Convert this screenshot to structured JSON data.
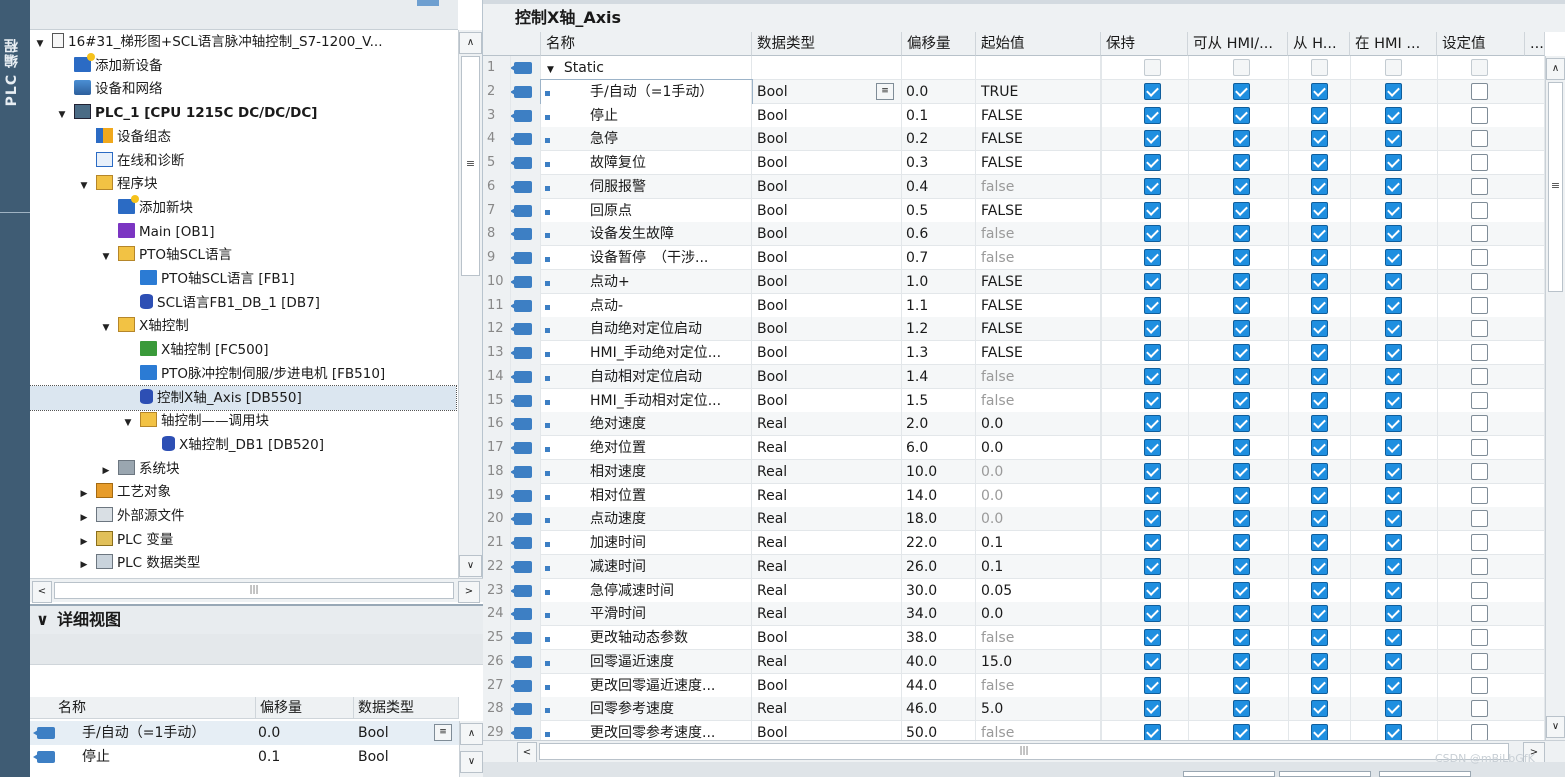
{
  "side_tab": {
    "label": "PLC 编程"
  },
  "tree": {
    "items": [
      {
        "label": "16#31_梯形图+SCL语言脉冲轴控制_S7-1200_V...",
        "icon": "project-icon",
        "toggle": "▼",
        "indent": 0
      },
      {
        "label": "添加新设备",
        "icon": "add-device-icon",
        "toggle": "",
        "indent": 1
      },
      {
        "label": "设备和网络",
        "icon": "network-icon",
        "toggle": "",
        "indent": 1
      },
      {
        "label": "PLC_1 [CPU 1215C DC/DC/DC]",
        "icon": "plc-icon",
        "toggle": "▼",
        "indent": 1
      },
      {
        "label": "设备组态",
        "icon": "device-config-icon",
        "toggle": "",
        "indent": 2
      },
      {
        "label": "在线和诊断",
        "icon": "diagnostics-icon",
        "toggle": "",
        "indent": 2
      },
      {
        "label": "程序块",
        "icon": "folder-icon",
        "toggle": "▼",
        "indent": 2
      },
      {
        "label": "添加新块",
        "icon": "add-block-icon",
        "toggle": "",
        "indent": 3
      },
      {
        "label": "Main [OB1]",
        "icon": "ob-icon",
        "toggle": "",
        "indent": 3
      },
      {
        "label": "PTO轴SCL语言",
        "icon": "folder-icon",
        "toggle": "▼",
        "indent": 3
      },
      {
        "label": "PTO轴SCL语言 [FB1]",
        "icon": "fb-icon",
        "toggle": "",
        "indent": 4
      },
      {
        "label": "SCL语言FB1_DB_1 [DB7]",
        "icon": "db-icon",
        "toggle": "",
        "indent": 4
      },
      {
        "label": "X轴控制",
        "icon": "folder-icon",
        "toggle": "▼",
        "indent": 3
      },
      {
        "label": "X轴控制 [FC500]",
        "icon": "fc-icon",
        "toggle": "",
        "indent": 4
      },
      {
        "label": "PTO脉冲控制伺服/步进电机 [FB510]",
        "icon": "fb-icon",
        "toggle": "",
        "indent": 4
      },
      {
        "label": "控制X轴_Axis [DB550]",
        "icon": "db-icon",
        "toggle": "",
        "indent": 4,
        "selected": true
      },
      {
        "label": "轴控制——调用块",
        "icon": "folder-icon",
        "toggle": "▼",
        "indent": 4
      },
      {
        "label": "X轴控制_DB1 [DB520]",
        "icon": "db-icon",
        "toggle": "",
        "indent": 5
      },
      {
        "label": "系统块",
        "icon": "system-block-icon",
        "toggle": "▶",
        "indent": 3
      },
      {
        "label": "工艺对象",
        "icon": "technology-object-icon",
        "toggle": "▶",
        "indent": 2
      },
      {
        "label": "外部源文件",
        "icon": "external-source-icon",
        "toggle": "▶",
        "indent": 2
      },
      {
        "label": "PLC 变量",
        "icon": "plc-tags-icon",
        "toggle": "▶",
        "indent": 2
      },
      {
        "label": "PLC 数据类型",
        "icon": "plc-datatype-icon",
        "toggle": "▶",
        "indent": 2
      }
    ]
  },
  "detail": {
    "title": "详细视图",
    "toggle": "∨",
    "headers": [
      "名称",
      "偏移量",
      "数据类型"
    ],
    "rows": [
      {
        "name": "手/自动（=1手动）",
        "offset": "0.0",
        "type": "Bool"
      },
      {
        "name": "停止",
        "offset": "0.1",
        "type": "Bool"
      }
    ]
  },
  "editor": {
    "title": "控制X轴_Axis",
    "headers": [
      "名称",
      "数据类型",
      "偏移量",
      "起始值",
      "保持",
      "可从 HMI/...",
      "从 H...",
      "在 HMI ...",
      "设定值",
      "..."
    ],
    "rows": [
      {
        "n": "1",
        "name": "Static",
        "type": "",
        "offset": "",
        "start": "",
        "retain": false,
        "hmi_access": false,
        "from_hmi": false,
        "in_hmi": false,
        "setpoint": false,
        "section": true
      },
      {
        "n": "2",
        "name": "手/自动（=1手动）",
        "type": "Bool",
        "offset": "0.0",
        "start": "TRUE",
        "retain": true,
        "hmi_access": true,
        "from_hmi": true,
        "in_hmi": true,
        "setpoint": false,
        "editing": true
      },
      {
        "n": "3",
        "name": "停止",
        "type": "Bool",
        "offset": "0.1",
        "start": "FALSE",
        "retain": true,
        "hmi_access": true,
        "from_hmi": true,
        "in_hmi": true,
        "setpoint": false
      },
      {
        "n": "4",
        "name": "急停",
        "type": "Bool",
        "offset": "0.2",
        "start": "FALSE",
        "retain": true,
        "hmi_access": true,
        "from_hmi": true,
        "in_hmi": true,
        "setpoint": false
      },
      {
        "n": "5",
        "name": "故障复位",
        "type": "Bool",
        "offset": "0.3",
        "start": "FALSE",
        "retain": true,
        "hmi_access": true,
        "from_hmi": true,
        "in_hmi": true,
        "setpoint": false
      },
      {
        "n": "6",
        "name": "伺服报警",
        "type": "Bool",
        "offset": "0.4",
        "start": "false",
        "retain": true,
        "hmi_access": true,
        "from_hmi": true,
        "in_hmi": true,
        "setpoint": false
      },
      {
        "n": "7",
        "name": "回原点",
        "type": "Bool",
        "offset": "0.5",
        "start": "FALSE",
        "retain": true,
        "hmi_access": true,
        "from_hmi": true,
        "in_hmi": true,
        "setpoint": false
      },
      {
        "n": "8",
        "name": "设备发生故障",
        "type": "Bool",
        "offset": "0.6",
        "start": "false",
        "retain": true,
        "hmi_access": true,
        "from_hmi": true,
        "in_hmi": true,
        "setpoint": false
      },
      {
        "n": "9",
        "name": "设备暂停　（干涉...",
        "type": "Bool",
        "offset": "0.7",
        "start": "false",
        "retain": true,
        "hmi_access": true,
        "from_hmi": true,
        "in_hmi": true,
        "setpoint": false
      },
      {
        "n": "10",
        "name": "点动+",
        "type": "Bool",
        "offset": "1.0",
        "start": "FALSE",
        "retain": true,
        "hmi_access": true,
        "from_hmi": true,
        "in_hmi": true,
        "setpoint": false
      },
      {
        "n": "11",
        "name": "点动-",
        "type": "Bool",
        "offset": "1.1",
        "start": "FALSE",
        "retain": true,
        "hmi_access": true,
        "from_hmi": true,
        "in_hmi": true,
        "setpoint": false
      },
      {
        "n": "12",
        "name": "自动绝对定位启动",
        "type": "Bool",
        "offset": "1.2",
        "start": "FALSE",
        "retain": true,
        "hmi_access": true,
        "from_hmi": true,
        "in_hmi": true,
        "setpoint": false
      },
      {
        "n": "13",
        "name": "HMI_手动绝对定位...",
        "type": "Bool",
        "offset": "1.3",
        "start": "FALSE",
        "retain": true,
        "hmi_access": true,
        "from_hmi": true,
        "in_hmi": true,
        "setpoint": false
      },
      {
        "n": "14",
        "name": "自动相对定位启动",
        "type": "Bool",
        "offset": "1.4",
        "start": "false",
        "retain": true,
        "hmi_access": true,
        "from_hmi": true,
        "in_hmi": true,
        "setpoint": false
      },
      {
        "n": "15",
        "name": "HMI_手动相对定位...",
        "type": "Bool",
        "offset": "1.5",
        "start": "false",
        "retain": true,
        "hmi_access": true,
        "from_hmi": true,
        "in_hmi": true,
        "setpoint": false
      },
      {
        "n": "16",
        "name": "绝对速度",
        "type": "Real",
        "offset": "2.0",
        "start": "0.0",
        "retain": true,
        "hmi_access": true,
        "from_hmi": true,
        "in_hmi": true,
        "setpoint": false
      },
      {
        "n": "17",
        "name": "绝对位置",
        "type": "Real",
        "offset": "6.0",
        "start": "0.0",
        "retain": true,
        "hmi_access": true,
        "from_hmi": true,
        "in_hmi": true,
        "setpoint": false
      },
      {
        "n": "18",
        "name": "相对速度",
        "type": "Real",
        "offset": "10.0",
        "start": "0.0",
        "retain": true,
        "hmi_access": true,
        "from_hmi": true,
        "in_hmi": true,
        "setpoint": false,
        "dim": true
      },
      {
        "n": "19",
        "name": "相对位置",
        "type": "Real",
        "offset": "14.0",
        "start": "0.0",
        "retain": true,
        "hmi_access": true,
        "from_hmi": true,
        "in_hmi": true,
        "setpoint": false,
        "dim": true
      },
      {
        "n": "20",
        "name": "点动速度",
        "type": "Real",
        "offset": "18.0",
        "start": "0.0",
        "retain": true,
        "hmi_access": true,
        "from_hmi": true,
        "in_hmi": true,
        "setpoint": false,
        "dim": true
      },
      {
        "n": "21",
        "name": "加速时间",
        "type": "Real",
        "offset": "22.0",
        "start": "0.1",
        "retain": true,
        "hmi_access": true,
        "from_hmi": true,
        "in_hmi": true,
        "setpoint": false
      },
      {
        "n": "22",
        "name": "减速时间",
        "type": "Real",
        "offset": "26.0",
        "start": "0.1",
        "retain": true,
        "hmi_access": true,
        "from_hmi": true,
        "in_hmi": true,
        "setpoint": false
      },
      {
        "n": "23",
        "name": "急停减速时间",
        "type": "Real",
        "offset": "30.0",
        "start": "0.05",
        "retain": true,
        "hmi_access": true,
        "from_hmi": true,
        "in_hmi": true,
        "setpoint": false
      },
      {
        "n": "24",
        "name": "平滑时间",
        "type": "Real",
        "offset": "34.0",
        "start": "0.0",
        "retain": true,
        "hmi_access": true,
        "from_hmi": true,
        "in_hmi": true,
        "setpoint": false
      },
      {
        "n": "25",
        "name": "更改轴动态参数",
        "type": "Bool",
        "offset": "38.0",
        "start": "false",
        "retain": true,
        "hmi_access": true,
        "from_hmi": true,
        "in_hmi": true,
        "setpoint": false
      },
      {
        "n": "26",
        "name": "回零逼近速度",
        "type": "Real",
        "offset": "40.0",
        "start": "15.0",
        "retain": true,
        "hmi_access": true,
        "from_hmi": true,
        "in_hmi": true,
        "setpoint": false
      },
      {
        "n": "27",
        "name": "更改回零逼近速度...",
        "type": "Bool",
        "offset": "44.0",
        "start": "false",
        "retain": true,
        "hmi_access": true,
        "from_hmi": true,
        "in_hmi": true,
        "setpoint": false
      },
      {
        "n": "28",
        "name": "回零参考速度",
        "type": "Real",
        "offset": "46.0",
        "start": "5.0",
        "retain": true,
        "hmi_access": true,
        "from_hmi": true,
        "in_hmi": true,
        "setpoint": false
      },
      {
        "n": "29",
        "name": "更改回零参考速度...",
        "type": "Bool",
        "offset": "50.0",
        "start": "false",
        "retain": true,
        "hmi_access": true,
        "from_hmi": true,
        "in_hmi": true,
        "setpoint": false
      }
    ]
  },
  "scroll_glyphs": {
    "up": "∧",
    "down": "∨",
    "left": "<",
    "right": ">",
    "grip": "≡",
    "hgrip": "|||"
  },
  "watermark": "CSDN @mBiLbGfK",
  "colors": {
    "sidebar": "#3f5c74",
    "checkbox_on": "#1f8fe0",
    "header_bg": "#eef1f3"
  }
}
